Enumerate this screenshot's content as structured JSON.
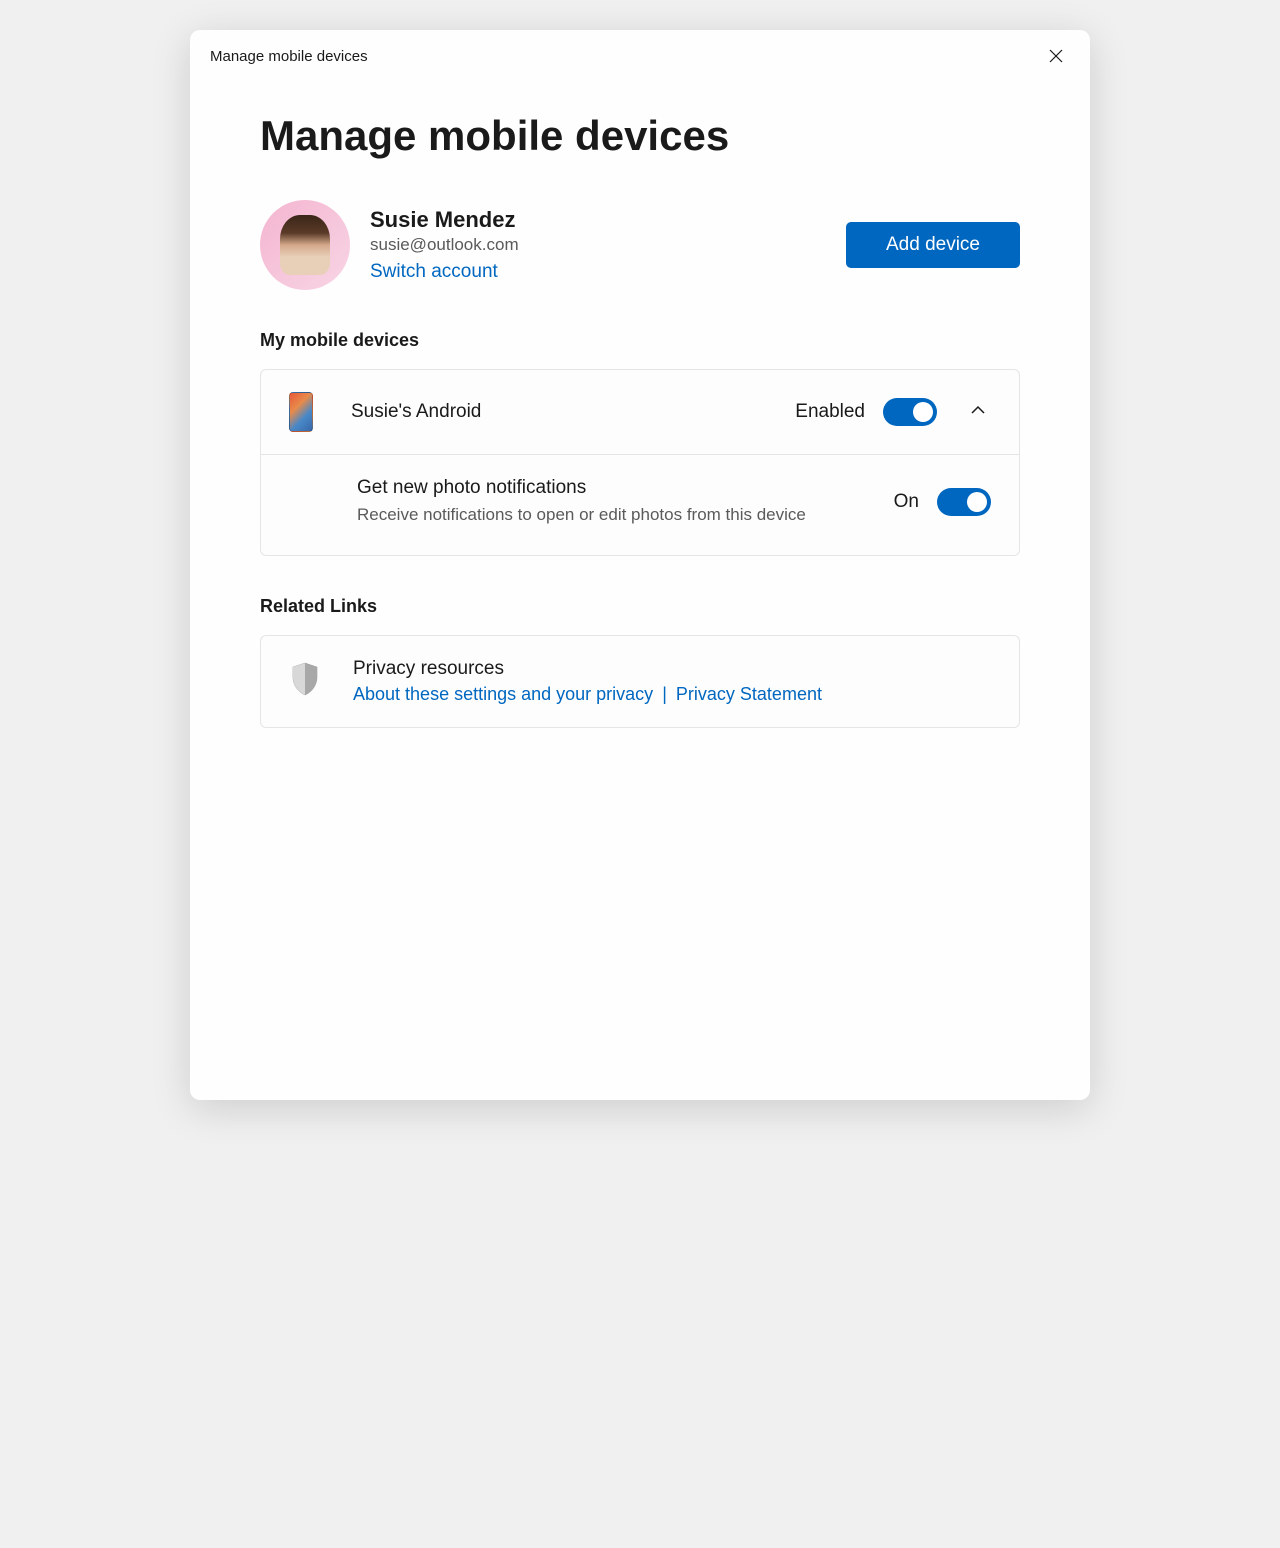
{
  "titlebar": {
    "title": "Manage mobile devices"
  },
  "page": {
    "heading": "Manage mobile devices"
  },
  "account": {
    "name": "Susie Mendez",
    "email": "susie@outlook.com",
    "switch_link": "Switch account",
    "add_button": "Add device"
  },
  "devices": {
    "section_heading": "My mobile devices",
    "list": [
      {
        "name": "Susie's Android",
        "status_label": "Enabled",
        "enabled": true,
        "expanded": true,
        "options": [
          {
            "title": "Get new photo notifications",
            "description": "Receive notifications to open or edit photos from this device",
            "status_label": "On",
            "enabled": true
          }
        ]
      }
    ]
  },
  "related": {
    "section_heading": "Related Links",
    "privacy": {
      "title": "Privacy resources",
      "link1": "About these settings and your privacy",
      "separator": "|",
      "link2": "Privacy Statement"
    }
  },
  "colors": {
    "accent": "#0067c0",
    "text_primary": "#1a1a1a",
    "text_secondary": "#5a5a5a",
    "border": "#e5e5e5"
  }
}
